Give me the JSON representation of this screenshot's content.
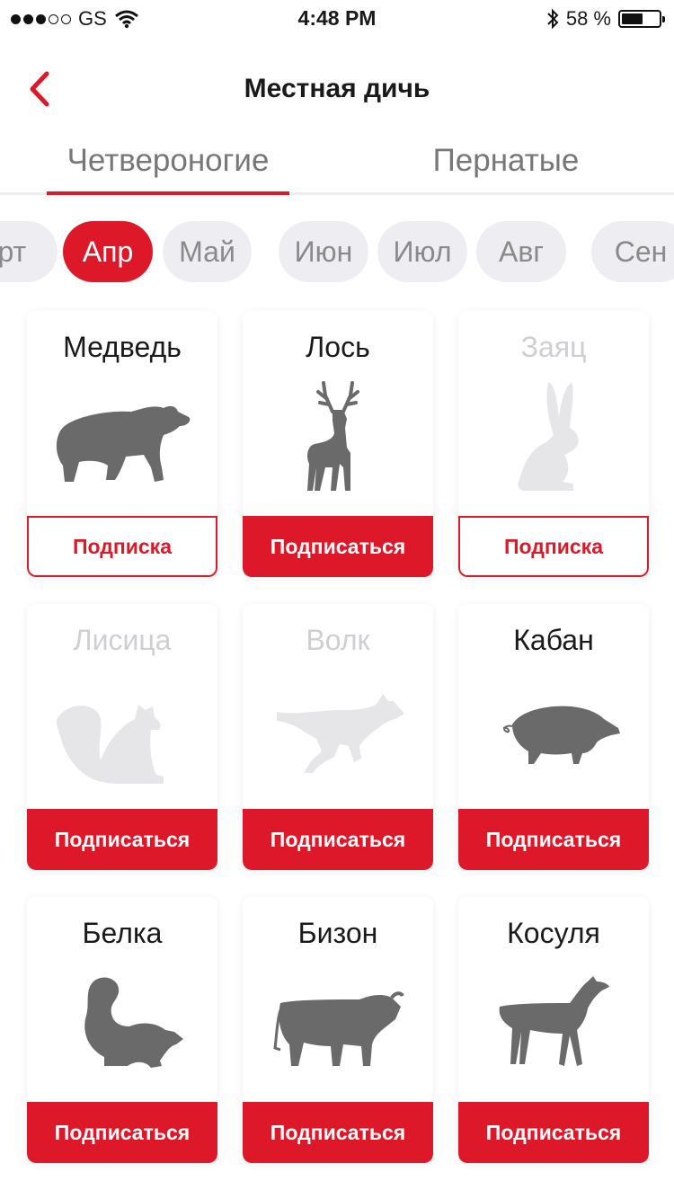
{
  "status_bar": {
    "carrier": "GS",
    "time": "4:48 PM",
    "battery": "58 %",
    "battery_level": 0.58
  },
  "nav": {
    "title": "Местная дичь"
  },
  "tabs": [
    {
      "label": "Четвероногие",
      "active": true
    },
    {
      "label": "Пернатые",
      "active": false
    }
  ],
  "months": [
    {
      "label": "Мрт",
      "active": false
    },
    {
      "label": "Апр",
      "active": true
    },
    {
      "label": "Май",
      "active": false
    },
    {
      "label": "Июн",
      "active": false
    },
    {
      "label": "Июл",
      "active": false
    },
    {
      "label": "Авг",
      "active": false
    },
    {
      "label": "Сен",
      "active": false
    }
  ],
  "animals": [
    {
      "name": "Медведь",
      "icon": "bear-icon",
      "button": "Подписка",
      "subscribed": true,
      "dimmed": false
    },
    {
      "name": "Лось",
      "icon": "moose-icon",
      "button": "Подписаться",
      "subscribed": false,
      "dimmed": false
    },
    {
      "name": "Заяц",
      "icon": "hare-icon",
      "button": "Подписка",
      "subscribed": true,
      "dimmed": true
    },
    {
      "name": "Лисица",
      "icon": "fox-icon",
      "button": "Подписаться",
      "subscribed": false,
      "dimmed": true
    },
    {
      "name": "Волк",
      "icon": "wolf-icon",
      "button": "Подписаться",
      "subscribed": false,
      "dimmed": true
    },
    {
      "name": "Кабан",
      "icon": "boar-icon",
      "button": "Подписаться",
      "subscribed": false,
      "dimmed": false
    },
    {
      "name": "Белка",
      "icon": "squirrel-icon",
      "button": "Подписаться",
      "subscribed": false,
      "dimmed": false
    },
    {
      "name": "Бизон",
      "icon": "bison-icon",
      "button": "Подписаться",
      "subscribed": false,
      "dimmed": false
    },
    {
      "name": "Косуля",
      "icon": "roe-deer-icon",
      "button": "Подписаться",
      "subscribed": false,
      "dimmed": false
    }
  ],
  "colors": {
    "accent": "#dd1929",
    "silhouette": "#6a6a6a",
    "silhouette_dim": "#e6e6e8"
  }
}
